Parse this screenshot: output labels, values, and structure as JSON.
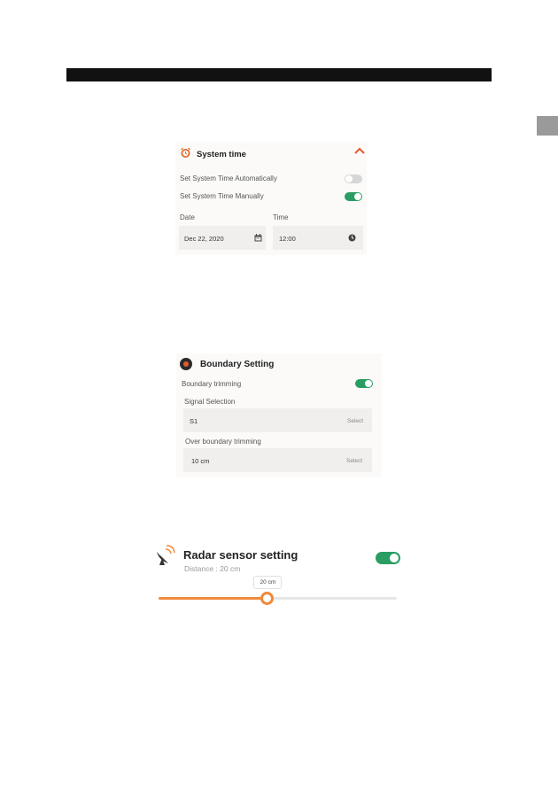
{
  "system_time": {
    "title": "System time",
    "auto_label": "Set System Time Automatically",
    "auto_enabled": false,
    "manual_label": "Set System Time  Manually",
    "manual_enabled": true,
    "date_label": "Date",
    "date_value": "Dec 22, 2020",
    "time_label": "Time",
    "time_value": "12:00"
  },
  "boundary": {
    "title": "Boundary Setting",
    "trimming_label": "Boundary trimming",
    "trimming_enabled": true,
    "signal_label": "Signal Selection",
    "signal_value": "S1",
    "signal_action": "Select",
    "over_label": "Over boundary trimming",
    "over_value": "10 cm",
    "over_action": "Select"
  },
  "radar": {
    "title": "Radar sensor setting",
    "subtitle": "Distance : 20 cm",
    "enabled": true,
    "slider_label": "20 cm",
    "slider_fraction": 0.455
  },
  "colors": {
    "accent": "#ef8a3d",
    "toggle_on": "#2a9d63",
    "toggle_off": "#d6d6d6"
  }
}
